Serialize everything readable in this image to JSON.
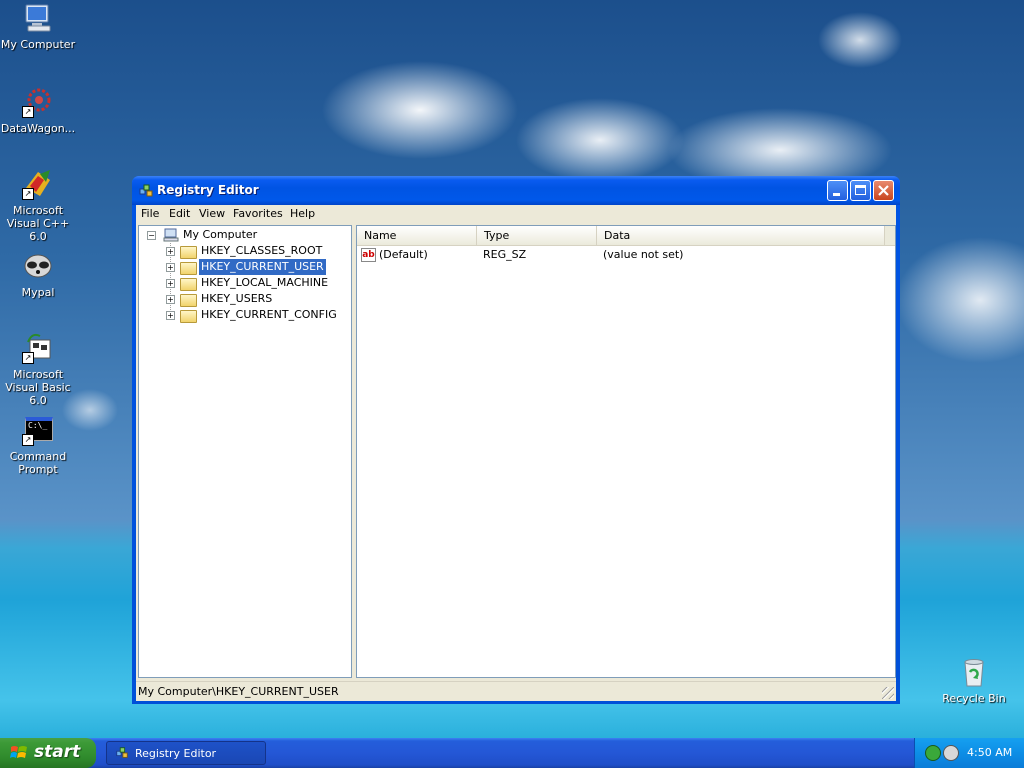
{
  "desktop": {
    "icons": [
      {
        "label": "My Computer"
      },
      {
        "label": "DataWagon..."
      },
      {
        "label": "Microsoft Visual C++ 6.0"
      },
      {
        "label": "Mypal"
      },
      {
        "label": "Microsoft Visual Basic 6.0"
      },
      {
        "label": "Command Prompt"
      },
      {
        "label": "Recycle Bin"
      }
    ],
    "cmd_text": "C:\\_"
  },
  "window": {
    "title": "Registry Editor",
    "menu": [
      "File",
      "Edit",
      "View",
      "Favorites",
      "Help"
    ],
    "tree": {
      "root": "My Computer",
      "expander_collapsed": "+",
      "expander_expanded": "−",
      "keys": [
        "HKEY_CLASSES_ROOT",
        "HKEY_CURRENT_USER",
        "HKEY_LOCAL_MACHINE",
        "HKEY_USERS",
        "HKEY_CURRENT_CONFIG"
      ],
      "selected_index": 1
    },
    "list": {
      "columns": [
        "Name",
        "Type",
        "Data"
      ],
      "rows": [
        {
          "icon": "ab",
          "name": "(Default)",
          "type": "REG_SZ",
          "data": "(value not set)"
        }
      ]
    },
    "status": "My Computer\\HKEY_CURRENT_USER"
  },
  "taskbar": {
    "start_label": "start",
    "tasks": [
      {
        "label": "Registry Editor"
      }
    ],
    "clock": "4:50 AM"
  },
  "colors": {
    "selection": "#316ac5",
    "titlebar": "#0054e3",
    "start_button": "#3c9a37"
  }
}
